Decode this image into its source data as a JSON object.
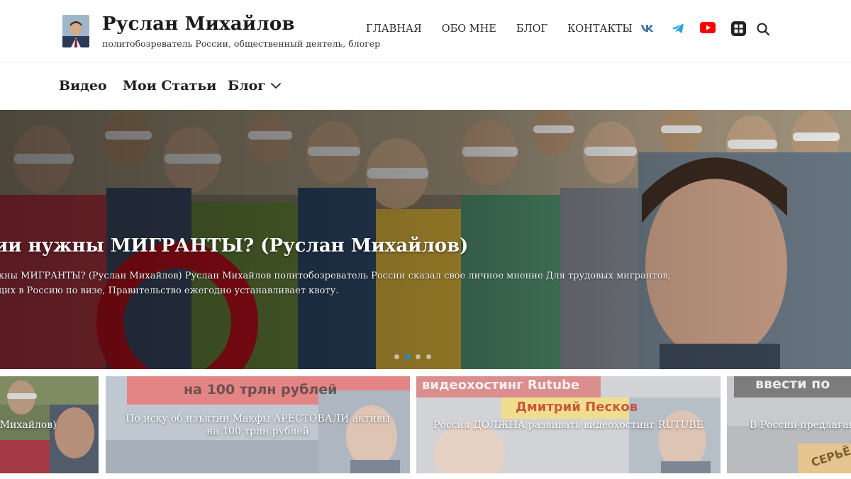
{
  "header": {
    "title": "Руслан Михайлов",
    "tagline": "политобозреватель России, общественный деятель, блогер",
    "nav": [
      "ГЛАВНАЯ",
      "ОБО МНЕ",
      "БЛОГ",
      "КОНТАКТЫ"
    ],
    "social_icons": [
      "vk-icon",
      "telegram-icon",
      "youtube-icon",
      "rutube-icon"
    ],
    "search_icon": "search-icon"
  },
  "menu": {
    "items": [
      "Видео",
      "Мои Статьи",
      "Блог"
    ],
    "dropdown_icon": "chevron-down-icon"
  },
  "hero": {
    "title": "ии нужны МИГРАНТЫ? (Руслан Михайлов)",
    "desc_line1": "жны МИГРАНТЫ? (Руслан Михайлов) Руслан Михайлов политобозреватель России сказал свое личное мнение Для трудовых мигрантов,",
    "desc_line2": "щих в Россию по визе, Правительство ежегодно устанавливает квоту.",
    "slide_count": 4,
    "active_slide": 2
  },
  "cards": [
    {
      "caption": "н Михайлов)"
    },
    {
      "caption": "По иску об изъятии Макфы АРЕСТОВАЛИ активы на 100 трлн рублей",
      "banner": "на 100 трлн рублей"
    },
    {
      "caption": "Россия ДОЛЖНА развивать видеохостинг RUTUBE",
      "banner": "видеохостинг Rutube",
      "banner2": "Дмитрий Песков"
    },
    {
      "caption": "В России предлагают",
      "banner": "ввести по",
      "banner2": "СЕРЬЁ"
    }
  ],
  "colors": {
    "accent": "#1e88e5",
    "vk": "#4a76a8",
    "telegram": "#2aa3df",
    "youtube": "#ff0000",
    "rutube": "#222222"
  }
}
